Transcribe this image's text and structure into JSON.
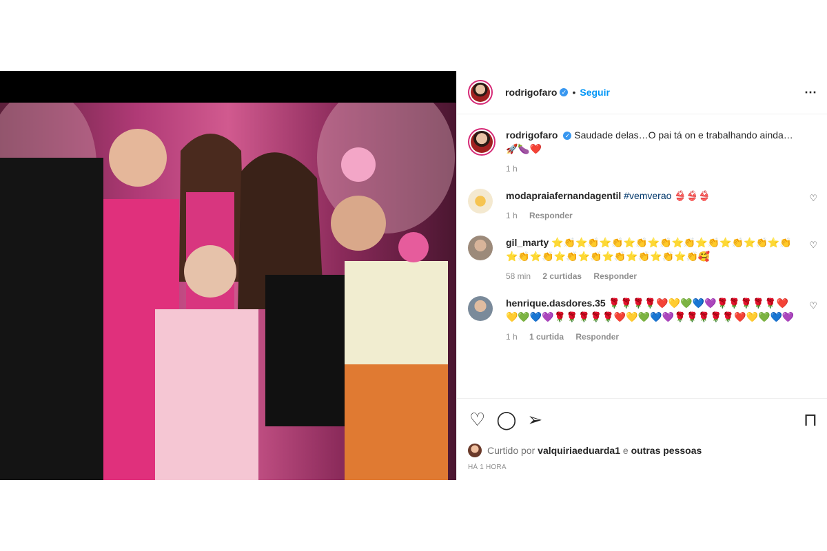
{
  "header": {
    "username": "rodrigofaro",
    "verified_symbol": "✓",
    "separator": "•",
    "follow_label": "Seguir",
    "more_icon": "⋯"
  },
  "caption": {
    "username": "rodrigofaro",
    "text": "Saudade delas…O pai tá on e trabalhando ainda…🚀🍆❤️",
    "time": "1 h"
  },
  "comments": [
    {
      "username": "modapraiafernandagentil",
      "hashtag": "#vemverao",
      "text": "👙👙👙",
      "time": "1 h",
      "likes": "",
      "reply_label": "Responder",
      "avatar_color": "#f4e9d0"
    },
    {
      "username": "gil_marty",
      "hashtag": "",
      "text": "⭐👏⭐👏⭐👏⭐👏⭐👏⭐👏⭐👏⭐👏⭐👏⭐👏⭐👏⭐👏⭐👏⭐👏⭐👏⭐👏⭐👏⭐👏🥰",
      "time": "58 min",
      "likes": "2 curtidas",
      "reply_label": "Responder",
      "avatar_color": "#9c8a7a"
    },
    {
      "username": "henrique.dasdores.35",
      "hashtag": "",
      "text": "🌹🌹🌹🌹❤️💛💚💙💜🌹🌹🌹🌹🌹❤️💛💚💙💜🌹🌹🌹🌹🌹❤️💛💚💙💜🌹🌹🌹🌹🌹❤️💛💚💙💜",
      "time": "1 h",
      "likes": "1 curtida",
      "reply_label": "Responder",
      "avatar_color": "#7a8a9a"
    }
  ],
  "actions": {
    "like_icon": "♡",
    "comment_icon": "◯",
    "share_icon": "➢",
    "save_icon": "⊓",
    "comment_like_icon": "♡"
  },
  "likes": {
    "prefix": "Curtido por",
    "user": "valquiriaeduarda1",
    "middle": "e",
    "suffix": "outras pessoas"
  },
  "timestamp": "HÁ 1 HORA",
  "colors": {
    "link": "#0095f6",
    "verified": "#3897f0",
    "hashtag": "#00376b"
  }
}
